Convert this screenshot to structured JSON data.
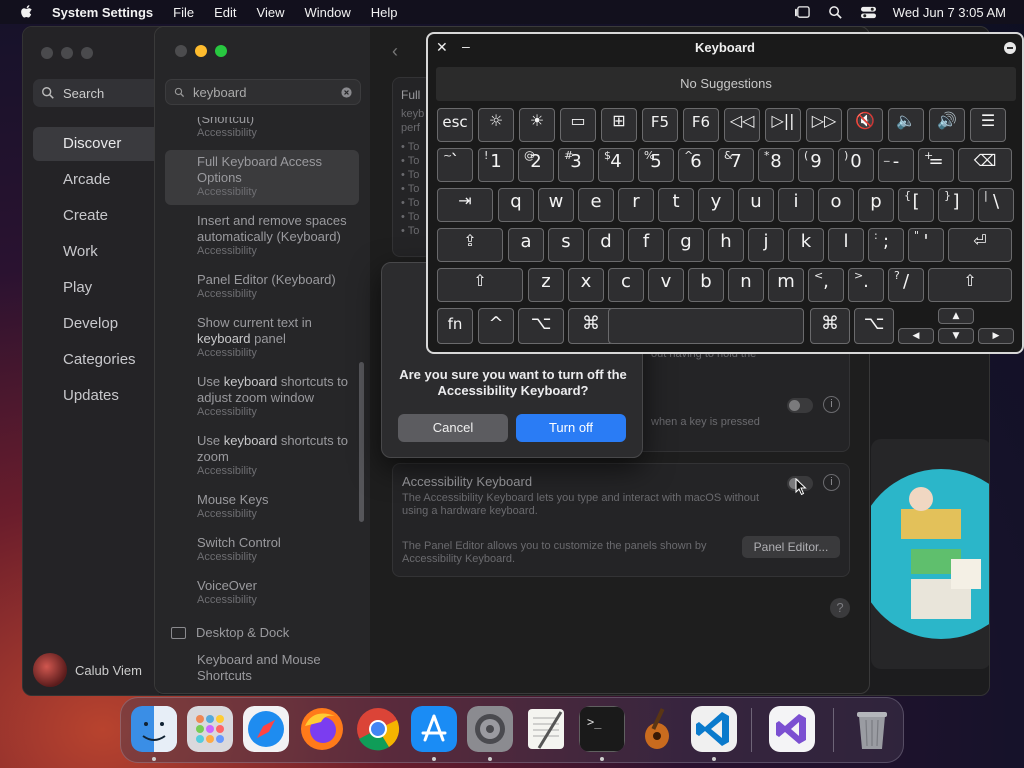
{
  "menubar": {
    "app_name": "System Settings",
    "menus": [
      "File",
      "Edit",
      "View",
      "Window",
      "Help"
    ],
    "clock": "Wed Jun 7  3:05 AM"
  },
  "appstore": {
    "search_placeholder": "Search",
    "nav": [
      "Discover",
      "Arcade",
      "Create",
      "Work",
      "Play",
      "Develop",
      "Categories",
      "Updates"
    ],
    "active_nav": "Discover",
    "user_name": "Calub Viem"
  },
  "settings": {
    "search_value": "keyboard",
    "results": [
      {
        "title_pre": "(Shortcut)",
        "title_kw": "",
        "title_post": "",
        "sub": "Accessibility"
      },
      {
        "title_pre": "Full Keyboard Access Options",
        "title_kw": "",
        "title_post": "",
        "sub": "Accessibility",
        "active": true
      },
      {
        "title_pre": "Insert and remove spaces automatically (Keyboard)",
        "title_kw": "",
        "title_post": "",
        "sub": "Accessibility"
      },
      {
        "title_pre": "Panel Editor (Keyboard)",
        "title_kw": "",
        "title_post": "",
        "sub": "Accessibility"
      },
      {
        "title_pre": "Show current text in ",
        "title_kw": "keyboard",
        "title_post": " panel",
        "sub": "Accessibility"
      },
      {
        "title_pre": "Use ",
        "title_kw": "keyboard",
        "title_post": " shortcuts to adjust zoom window",
        "sub": "Accessibility"
      },
      {
        "title_pre": "Use ",
        "title_kw": "keyboard",
        "title_post": " shortcuts to zoom",
        "sub": "Accessibility"
      },
      {
        "title_pre": "Mouse Keys",
        "title_kw": "",
        "title_post": "",
        "sub": "Accessibility"
      },
      {
        "title_pre": "Switch Control",
        "title_kw": "",
        "title_post": "",
        "sub": "Accessibility"
      },
      {
        "title_pre": "VoiceOver",
        "title_kw": "",
        "title_post": "",
        "sub": "Accessibility"
      }
    ],
    "section": "Desktop & Dock",
    "section_next": "Keyboard and Mouse Shortcuts",
    "top_card": {
      "title": "Full",
      "sub": "keyb",
      "sub2": "perf",
      "bullets": [
        "• To",
        "• To",
        "• To",
        "• To",
        "• To",
        "• To",
        "• To"
      ]
    },
    "card_fragment_1": "out having to hold the",
    "card_fragment_2": "when a key is pressed",
    "acc_kbd_title": "Accessibility Keyboard",
    "acc_kbd_desc": "The Accessibility Keyboard lets you type and interact with macOS without using a hardware keyboard.",
    "panel_desc": "The Panel Editor allows you to customize the panels shown by Accessibility Keyboard.",
    "panel_button": "Panel Editor...",
    "help": "?",
    "info": "i"
  },
  "alert": {
    "message": "Are you sure you want to turn off the Accessibility Keyboard?",
    "cancel": "Cancel",
    "ok": "Turn off"
  },
  "keyboard": {
    "title": "Keyboard",
    "suggestions": "No Suggestions",
    "row_fn": [
      "esc",
      "☼",
      "☀",
      "▭",
      "⊞",
      "F5",
      "F6",
      "◁◁",
      "▷||",
      "▷▷",
      "🔇",
      "🔈",
      "🔊",
      "☰"
    ],
    "row_num": [
      {
        "m": "1",
        "s": "!"
      },
      {
        "m": "2",
        "s": "@"
      },
      {
        "m": "3",
        "s": "#"
      },
      {
        "m": "4",
        "s": "$"
      },
      {
        "m": "5",
        "s": "%"
      },
      {
        "m": "6",
        "s": "^"
      },
      {
        "m": "7",
        "s": "&"
      },
      {
        "m": "8",
        "s": "*"
      },
      {
        "m": "9",
        "s": "("
      },
      {
        "m": "0",
        "s": ")"
      },
      {
        "m": "-",
        "s": "_"
      },
      {
        "m": "=",
        "s": "+"
      }
    ],
    "tilde": {
      "m": "`",
      "s": "~"
    },
    "row_q": [
      "q",
      "w",
      "e",
      "r",
      "t",
      "y",
      "u",
      "i",
      "o",
      "p"
    ],
    "row_q_extra": [
      {
        "m": "[",
        "s": "{"
      },
      {
        "m": "]",
        "s": "}"
      },
      {
        "m": "\\",
        "s": "|"
      }
    ],
    "row_a": [
      "a",
      "s",
      "d",
      "f",
      "g",
      "h",
      "j",
      "k",
      "l"
    ],
    "row_a_extra": [
      {
        "m": ";",
        "s": ":"
      },
      {
        "m": "'",
        "s": "\""
      }
    ],
    "row_z": [
      "z",
      "x",
      "c",
      "v",
      "b",
      "n",
      "m"
    ],
    "row_z_extra": [
      {
        "m": ",",
        "s": "<"
      },
      {
        "m": ".",
        "s": ">"
      },
      {
        "m": "/",
        "s": "?"
      }
    ],
    "tab": "⇥",
    "backspace": "⌫",
    "caps": "⇪",
    "ret": "⏎",
    "shift": "⇧",
    "fn": "fn",
    "ctrl": "^",
    "opt": "⌥",
    "cmd": "⌘",
    "arrows": {
      "up": "▲",
      "down": "▼",
      "left": "◀",
      "right": "▶"
    }
  },
  "colors": {
    "accent": "#2a7cf5",
    "traffic_red": "#ff5f57",
    "traffic_yellow": "#febc2e",
    "traffic_green": "#28c840"
  },
  "dock": {
    "apps": [
      "finder-icon",
      "launchpad-icon",
      "safari-icon",
      "firefox-icon",
      "chrome-icon",
      "app-store-icon",
      "system-settings-icon",
      "textedit-icon",
      "terminal-icon",
      "garageband-icon",
      "vscode-icon",
      "visual-studio-icon",
      "trash-icon"
    ],
    "terminal_prompt": ">_"
  }
}
